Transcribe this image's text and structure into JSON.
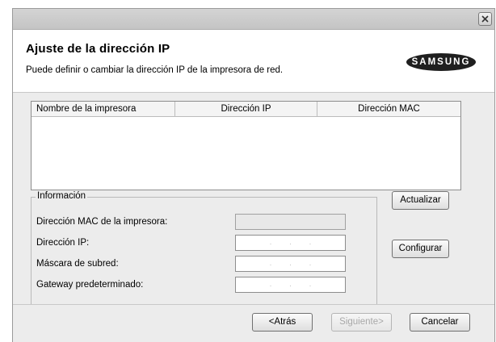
{
  "header": {
    "title": "Ajuste de la dirección IP",
    "subtitle": "Puede definir o cambiar la dirección IP de la impresora de red.",
    "logo_text": "SAMSUNG"
  },
  "list": {
    "columns": [
      "Nombre de la impresora",
      "Dirección IP",
      "Dirección MAC"
    ]
  },
  "info": {
    "legend": "Información",
    "mac_label": "Dirección MAC de la impresora:",
    "ip_label": "Dirección IP:",
    "mask_label": "Máscara de subred:",
    "gateway_label": "Gateway predeterminado:",
    "ip_dots": "...",
    "mask_dots": "...",
    "gateway_dots": "..."
  },
  "buttons": {
    "refresh": "Actualizar",
    "configure": "Configurar",
    "back": "<Atrás",
    "next": "Siguiente>",
    "cancel": "Cancelar"
  },
  "icons": {
    "close": "close-icon",
    "logo": "samsung-logo"
  }
}
